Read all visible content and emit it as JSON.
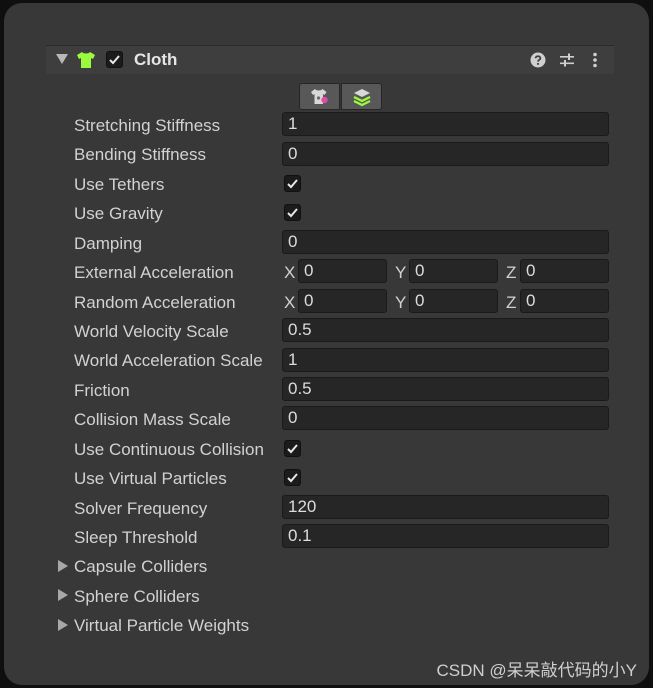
{
  "component": {
    "title": "Cloth",
    "enabled": true,
    "icon": "cloth-shirt-icon",
    "accent_color": "#9aff3a",
    "header_icons": [
      "help-icon",
      "preset-sliders-icon",
      "kebab-menu-icon"
    ],
    "tool_buttons": [
      "edit-constraints-icon",
      "select-self-collision-icon"
    ]
  },
  "props": {
    "stretching_stiffness": {
      "label": "Stretching Stiffness",
      "value": "1"
    },
    "bending_stiffness": {
      "label": "Bending Stiffness",
      "value": "0"
    },
    "use_tethers": {
      "label": "Use Tethers",
      "checked": true
    },
    "use_gravity": {
      "label": "Use Gravity",
      "checked": true
    },
    "damping": {
      "label": "Damping",
      "value": "0"
    },
    "external_acceleration": {
      "label": "External Acceleration",
      "x": "0",
      "y": "0",
      "z": "0"
    },
    "random_acceleration": {
      "label": "Random Acceleration",
      "x": "0",
      "y": "0",
      "z": "0"
    },
    "world_velocity_scale": {
      "label": "World Velocity Scale",
      "value": "0.5"
    },
    "world_acceleration_scale": {
      "label": "World Acceleration Scale",
      "value": "1"
    },
    "friction": {
      "label": "Friction",
      "value": "0.5"
    },
    "collision_mass_scale": {
      "label": "Collision Mass Scale",
      "value": "0"
    },
    "use_continuous_collision": {
      "label": "Use Continuous Collision",
      "checked": true
    },
    "use_virtual_particles": {
      "label": "Use Virtual Particles",
      "checked": true
    },
    "solver_frequency": {
      "label": "Solver Frequency",
      "value": "120"
    },
    "sleep_threshold": {
      "label": "Sleep Threshold",
      "value": "0.1"
    }
  },
  "axes": {
    "x": "X",
    "y": "Y",
    "z": "Z"
  },
  "foldouts": {
    "capsule": "Capsule Colliders",
    "sphere": "Sphere Colliders",
    "virtual_weights": "Virtual Particle Weights"
  },
  "watermark": "CSDN @呆呆敲代码的小Y"
}
